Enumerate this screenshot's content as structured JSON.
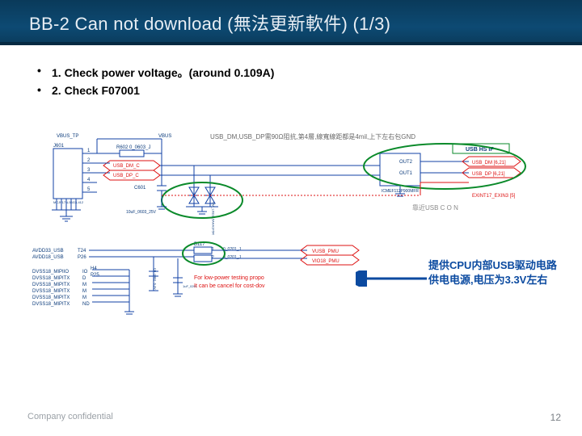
{
  "slide": {
    "title": "BB-2 Can not download (無法更新軟件) (1/3)",
    "bullets": [
      "1. Check power voltage。(around 0.109A)",
      "2. Check F07001"
    ],
    "annotation": "提供CPU内部USB驱动电路供电电源,电压为3.3V左右",
    "footer": "Company confidential",
    "page": "12"
  },
  "schematic": {
    "top_note": "USB_DM,USB_DP需90Ω阻抗,第4層,線寬線距都是4mil,上下左右包GND",
    "nets": {
      "vbus": "VBUS",
      "vbus_tp": "VBUS_TP",
      "usb_dm_c": "USB_DM_C",
      "usb_dp_c": "USB_DP_C",
      "usb_dm": "USB_DM  [6,21]",
      "usb_dp": "USB_DP  [6,21]",
      "usb_hs_if": "USB HS IF",
      "usbcon_note": "靠近USB C O N",
      "extint": "EXINT17_EXIN3   [5]",
      "avdd33": "AVDD33_USB",
      "avdd18": "AVDD18_USB",
      "vusb_pmu": "VUSB_PMU",
      "vio18_pmu": "VIO18_PMU"
    },
    "parts": {
      "j601": "J601",
      "j601_pn": "MCJF17N-56G3-412",
      "r602": "R602   0_0603_J",
      "c601": "C601",
      "c601_val": "10uF_0603_25V",
      "c602": "C0_0402_6.3V",
      "b117": "B117",
      "r1": "0_0201_J",
      "r2": "0_0201_J",
      "diodes": "NM_LXES15AAA1F5R",
      "filter": "ICMEF112P900MFR",
      "filter_out1": "OUT1",
      "filter_out2": "OUT2",
      "t24": "T24",
      "p26": "P26",
      "h4": "H4",
      "p25": "P25"
    },
    "mipi_pins": [
      "DVSS18_MIPIIO",
      "DVSS18_MIPITX",
      "DVSS18_MIPITX",
      "DVSS18_MIPITX",
      "DVSS18_MIPITX",
      "DVSS18_MIPITX"
    ],
    "mipi_right": [
      "IO",
      "D",
      "M",
      "M",
      "M",
      "ND"
    ],
    "low_power_note1": "For low-power testing propo",
    "low_power_note2": "It can be cancel for cost-dov"
  }
}
